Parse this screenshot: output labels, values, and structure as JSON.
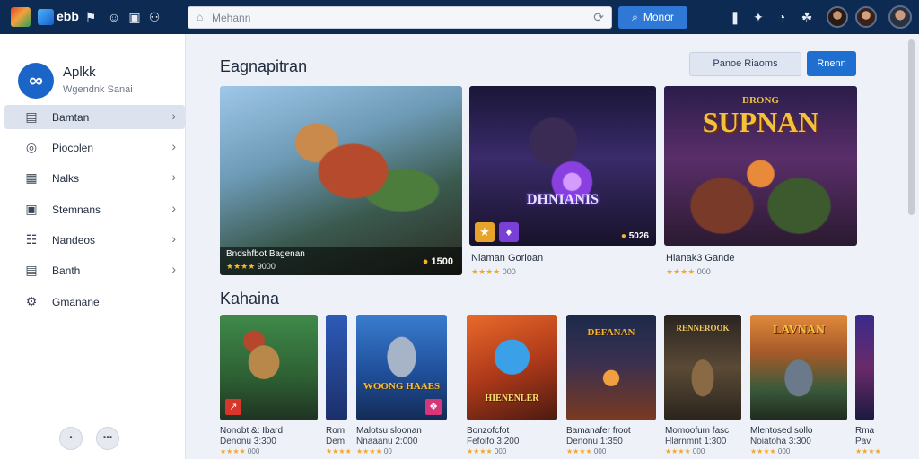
{
  "topbar": {
    "app_name": "ebb",
    "search_placeholder": "Mehann",
    "search_button": "Monor"
  },
  "sidebar": {
    "profile_name": "Aplkk",
    "profile_subtitle": "Wgendnk Sanai",
    "items": [
      {
        "label": "Bamtan",
        "icon": "bookmark-icon",
        "active": true
      },
      {
        "label": "Piocolen",
        "icon": "compass-icon",
        "active": false
      },
      {
        "label": "Nalks",
        "icon": "calendar-icon",
        "active": false
      },
      {
        "label": "Stemnans",
        "icon": "briefcase-icon",
        "active": false
      },
      {
        "label": "Nandeos",
        "icon": "grid-icon",
        "active": false
      },
      {
        "label": "Banth",
        "icon": "card-icon",
        "active": false
      },
      {
        "label": "Gmanane",
        "icon": "gear-icon",
        "active": false
      }
    ],
    "bottom_buttons": [
      "•",
      "•••"
    ]
  },
  "main": {
    "featured_title": "Eagnapitran",
    "filter_button": "Panoe Riaoms",
    "primary_button": "Rnenn",
    "featured": [
      {
        "inner_title": "Bndshfbot Bagenan",
        "stars": "★★★★",
        "count": "9000",
        "price": "1500"
      },
      {
        "art_text": "DHNIANIS",
        "price": "5026",
        "caption": "Nlaman Gorloan",
        "stars": "★★★★",
        "count": "000"
      },
      {
        "art_text": "SUPNAN",
        "art_top": "DRONG",
        "caption": "Hlanak3 Gande",
        "stars": "★★★★",
        "count": "000"
      }
    ],
    "list_title": "Kahaina",
    "tiles": [
      {
        "title": "Nonobt &: Ibard",
        "sub": "Denonu 3:300",
        "stars": "★★★★",
        "count": "000"
      },
      {
        "title": "Rom",
        "sub": "Dem",
        "stars": "★★★★",
        "count": "00"
      },
      {
        "title": "Malotsu sloonan",
        "sub": "Nnaaanu 2:000",
        "stars": "★★★★",
        "count": "00"
      },
      {
        "title": "Bonzofcfot",
        "sub": "Fefoifo 3:200",
        "stars": "★★★★",
        "count": "000"
      },
      {
        "title": "Bamanafer froot",
        "sub": "Denonu 1:350",
        "stars": "★★★★",
        "count": "000"
      },
      {
        "title": "Momoofum fasc",
        "sub": "Hlarnmnt 1:300",
        "stars": "★★★★",
        "count": "000"
      },
      {
        "title": "Mlentosed sollo",
        "sub": "Noiatoha 3:300",
        "stars": "★★★★",
        "count": "000"
      },
      {
        "title": "Rma",
        "sub": "Pav",
        "stars": "★★★★",
        "count": "00"
      }
    ],
    "tile_art": [
      "",
      "",
      "WOONG HAAES",
      "HIENENLER",
      "DEFANAN",
      "RENNEROOK",
      "LAVNAN",
      ""
    ]
  },
  "colors": {
    "topbar": "#0d2a52",
    "accent": "#1f6fd0",
    "star": "#f4a62a"
  }
}
